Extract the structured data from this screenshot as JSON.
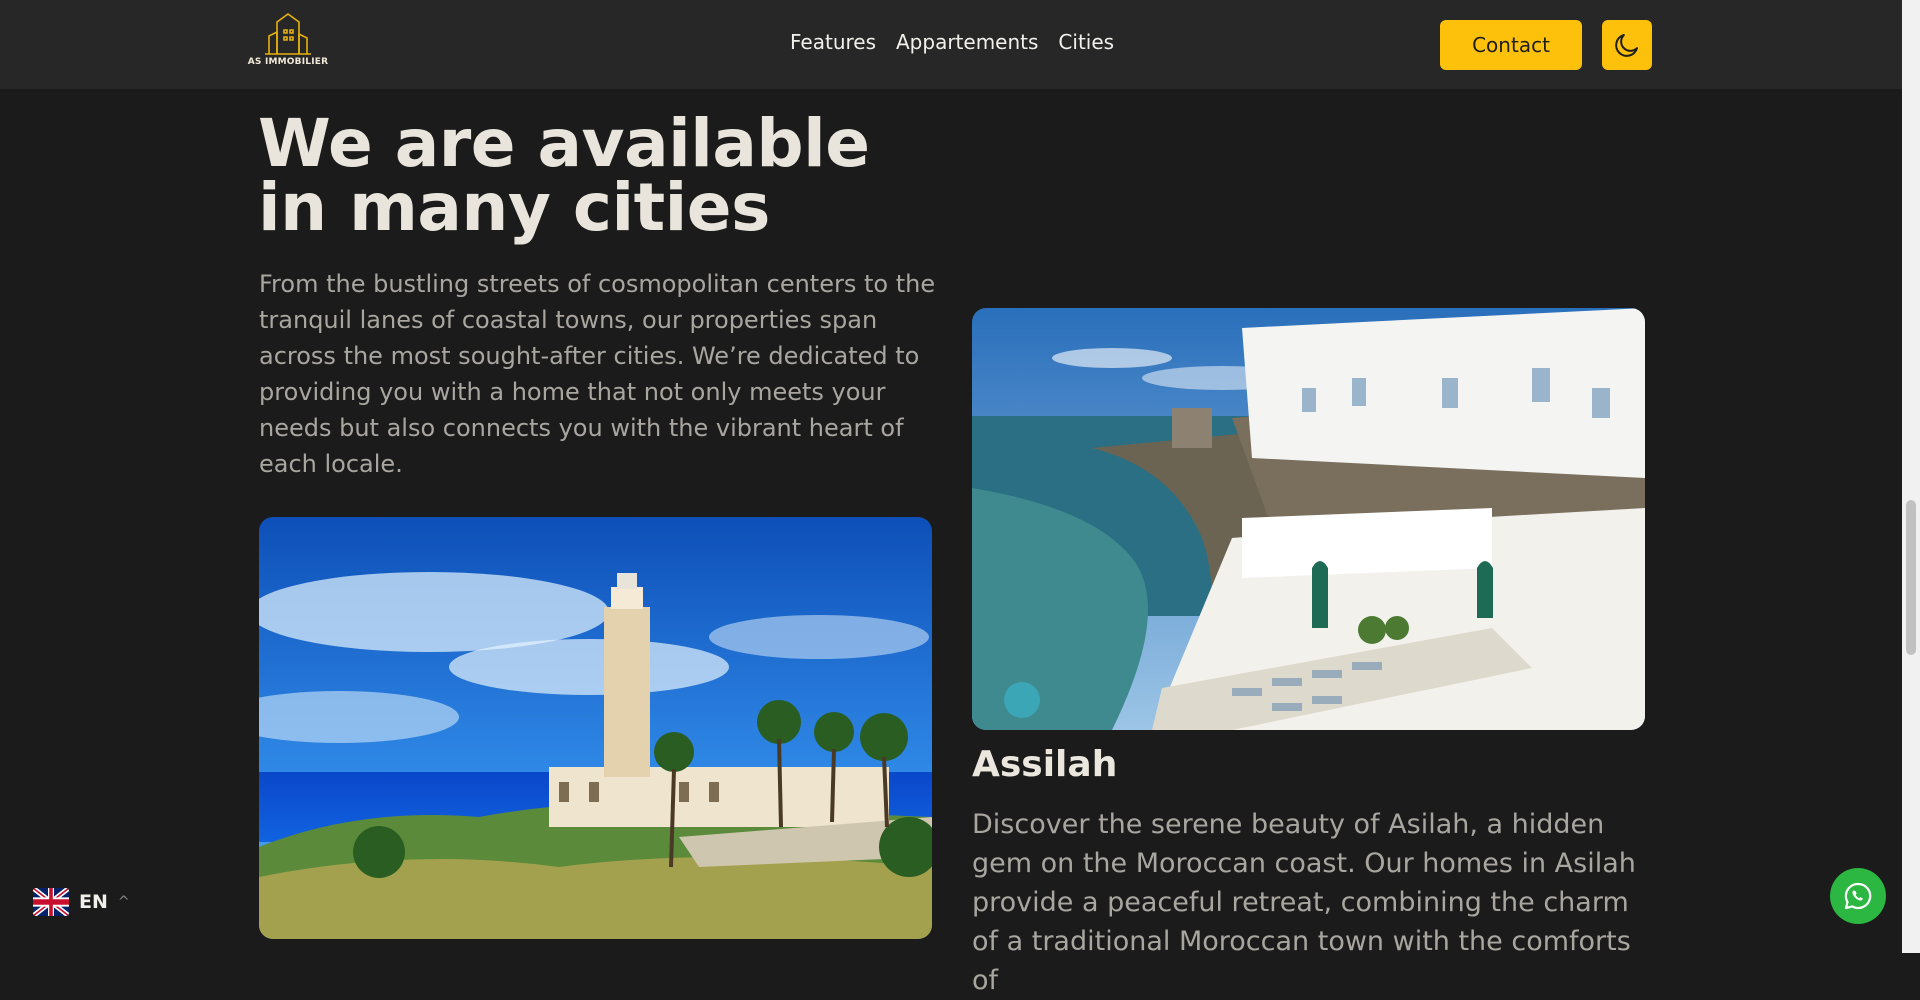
{
  "nav": {
    "logo_text": "AS IMMOBILIER",
    "links": [
      "Features",
      "Appartements",
      "Cities"
    ],
    "contact_label": "Contact",
    "theme_icon": "moon-icon"
  },
  "section": {
    "heading": "We are available in many cities",
    "intro": "From the bustling streets of cosmopolitan centers to the tranquil lanes of coastal towns, our properties span across the most sought-after cities. We’re dedicated to providing you with a home that not only meets your needs but also connects you with the vibrant heart of each locale."
  },
  "cities": [
    {
      "name": "Assilah",
      "description": "Discover the serene beauty of Asilah, a hidden gem on the Moroccan coast. Our homes in Asilah provide a peaceful retreat, combining the charm of a traditional Moroccan town with the comforts of"
    }
  ],
  "language": {
    "code": "EN",
    "flag_icon": "uk-flag-icon"
  },
  "colors": {
    "accent": "#fdc10c",
    "background": "#1b1b1b",
    "nav": "#272727",
    "whatsapp": "#2bb741"
  }
}
